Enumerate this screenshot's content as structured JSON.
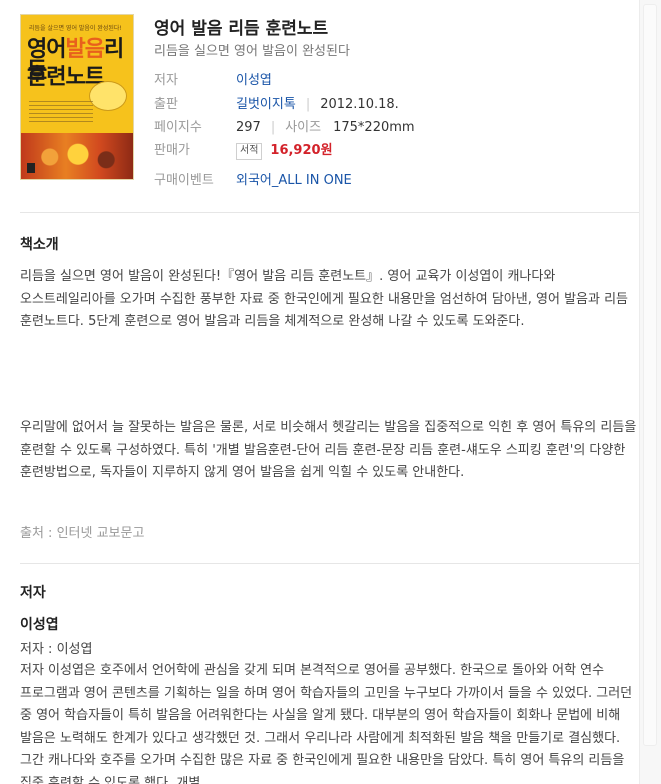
{
  "book": {
    "cover_title_top": "리듬을 살으면 영어 발음이 완성된다!",
    "cover_title_l1a": "영어",
    "cover_title_l1b": "발음",
    "cover_title_l1c": "리듬",
    "cover_title_l2": "훈련노트",
    "title": "영어 발음 리듬 훈련노트",
    "subtitle": "리듬을 실으면 영어 발음이 완성된다"
  },
  "info": {
    "author_label": "저자",
    "author_value": "이성엽",
    "publisher_label": "출판",
    "publisher_value": "길벗이지톡",
    "pub_date": "2012.10.18.",
    "pages_label": "페이지수",
    "pages_value": "297",
    "size_label": "사이즈",
    "size_value": "175*220mm",
    "price_label": "판매가",
    "price_badge": "서적",
    "price_value": "16,920원",
    "event_label": "구매이벤트",
    "event_value": "외국어_ALL IN ONE"
  },
  "intro": {
    "heading": "책소개",
    "para1": "리듬을 실으면 영어 발음이 완성된다!『영어 발음 리듬 훈련노트』. 영어 교육가 이성엽이 캐나다와 오스트레일리아를 오가며 수집한 풍부한 자료 중 한국인에게 필요한 내용만을 엄선하여 담아낸, 영어 발음과 리듬 훈련노트다. 5단계 훈련으로 영어 발음과 리듬을 체계적으로 완성해 나갈 수 있도록 도와준다.",
    "para2": "우리말에 없어서 늘 잘못하는 발음은 물론, 서로 비슷해서 헷갈리는 발음을 집중적으로 익힌 후 영어 특유의 리듬을 훈련할 수 있도록 구성하였다. 특히 '개별 발음훈련-단어 리듬 훈련-문장 리듬 훈련-섀도우 스피킹 훈련'의 다양한 훈련방법으로, 독자들이 지루하지 않게 영어 발음을 쉽게 익힐 수 있도록 안내한다.",
    "source": "출처 : 인터넷 교보문고"
  },
  "author": {
    "heading": "저자",
    "name": "이성엽",
    "sub": "저자 : 이성엽",
    "bio": "저자 이성엽은 호주에서 언어학에 관심을 갖게 되며 본격적으로 영어를 공부했다. 한국으로 돌아와 어학 연수 프로그램과 영어 콘텐츠를 기획하는 일을 하며 영어 학습자들의 고민을 누구보다 가까이서 들을 수 있었다. 그러던 중 영어 학습자들이 특히 발음을 어려워한다는 사실을 알게 됐다. 대부분의 영어 학습자들이 회화나 문법에 비해 발음은 노력해도 한계가 있다고 생각했던 것. 그래서 우리나라 사람에게 최적화된 발음 책을 만들기로 결심했다. 그간 캐나다와 호주를 오가며 수집한 많은 자료 중 한국인에게 필요한 내용만을 담았다. 특히 영어 특유의 리듬을 집중 훈련할 수 있도록 했다. 개별"
  }
}
